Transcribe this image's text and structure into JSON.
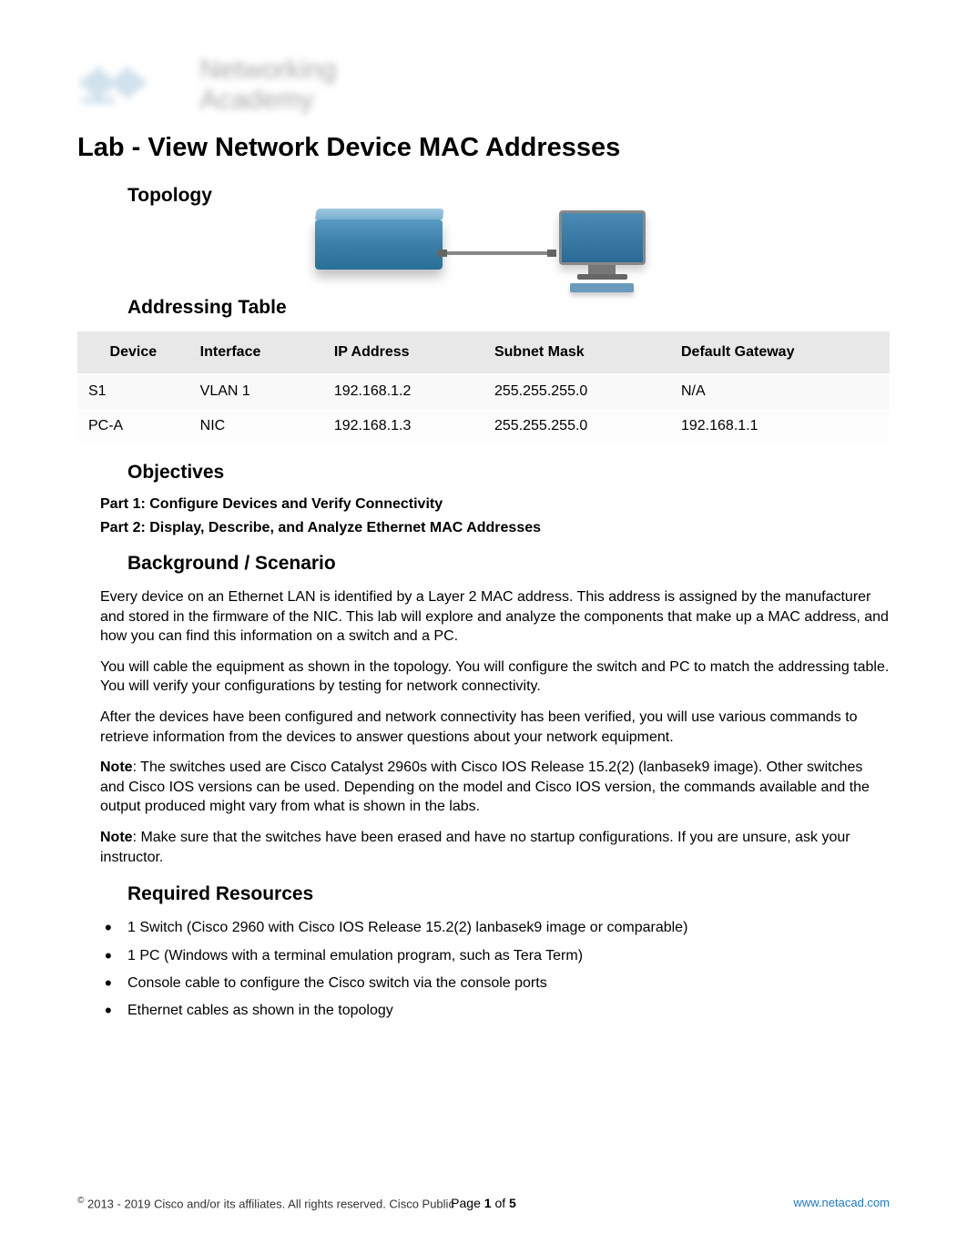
{
  "logo": {
    "line1": "Networking",
    "line2": "Academy"
  },
  "title": "Lab - View Network Device MAC Addresses",
  "sections": {
    "topology": "Topology",
    "addressing_table": "Addressing Table",
    "objectives": "Objectives",
    "background": "Background / Scenario",
    "required_resources": "Required Resources"
  },
  "table": {
    "headers": [
      "Device",
      "Interface",
      "IP Address",
      "Subnet Mask",
      "Default Gateway"
    ],
    "rows": [
      {
        "device": "S1",
        "interface": "VLAN 1",
        "ip": "192.168.1.2",
        "mask": "255.255.255.0",
        "gateway": "N/A"
      },
      {
        "device": "PC-A",
        "interface": "NIC",
        "ip": "192.168.1.3",
        "mask": "255.255.255.0",
        "gateway": "192.168.1.1"
      }
    ]
  },
  "objectives_lines": {
    "part1": "Part 1: Configure Devices and Verify Connectivity",
    "part2": "Part 2: Display, Describe, and Analyze Ethernet MAC Addresses"
  },
  "background_paras": {
    "p1": "Every device on an Ethernet LAN is identified by a Layer 2 MAC address. This address is assigned by the manufacturer and stored in the firmware of the NIC. This lab will explore and analyze the components that make up a MAC address, and how you can find this information on a switch and a PC.",
    "p2": "You will cable the equipment as shown in the topology. You will configure the switch and PC to match the addressing table. You will verify your configurations by testing for network connectivity.",
    "p3": "After the devices have been configured and network connectivity has been verified, you will use various commands to retrieve information from the devices to answer questions about your network equipment.",
    "note1_label": "Note",
    "note1_text": ": The switches used are Cisco Catalyst 2960s with Cisco IOS Release 15.2(2) (lanbasek9 image). Other switches and Cisco IOS versions can be used. Depending on the model and Cisco IOS version, the commands available and the output produced might vary from what is shown in the labs.",
    "note2_label": "Note",
    "note2_text": ": Make sure that the switches have been erased and have no startup configurations. If you are unsure, ask your instructor."
  },
  "resources": [
    "1 Switch (Cisco 2960 with Cisco IOS Release 15.2(2) lanbasek9 image or comparable)",
    "1 PC (Windows with a terminal emulation program, such as Tera Term)",
    "Console cable to configure the Cisco switch via the console ports",
    "Ethernet cables as shown in the topology"
  ],
  "footer": {
    "copyright_symbol": "©",
    "copyright": " 2013 - 2019 Cisco and/or its affiliates. All rights reserved. Cisco Public",
    "page_label_pre": "Page ",
    "page_current": "1",
    "page_label_mid": " of ",
    "page_total": "5",
    "link": "www.netacad.com"
  }
}
